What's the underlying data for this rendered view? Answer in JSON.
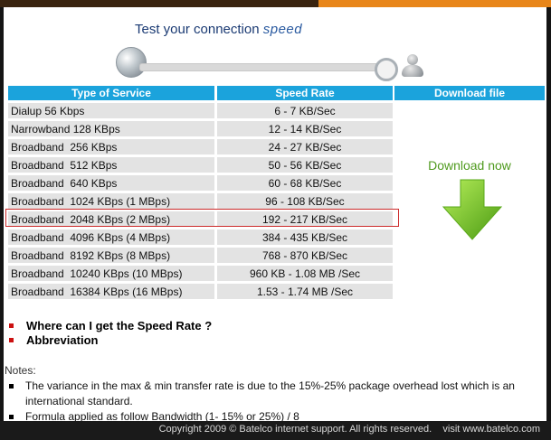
{
  "header": {
    "title_prefix": "Test your connection",
    "title_highlight": "speed"
  },
  "progress": {
    "start_icon": "globe-icon",
    "end_icon": "user-icon"
  },
  "table": {
    "headers": [
      "Type of Service",
      "Speed Rate"
    ],
    "rows": [
      {
        "type": "Dialup 56 Kbps",
        "rate": "6 - 7 KB/Sec"
      },
      {
        "type": "Narrowband 128 KBps",
        "rate": "12 - 14 KB/Sec"
      },
      {
        "type": "Broadband  256 KBps",
        "rate": "24 - 27 KB/Sec"
      },
      {
        "type": "Broadband  512 KBps",
        "rate": "50 - 56 KB/Sec"
      },
      {
        "type": "Broadband  640 KBps",
        "rate": "60 - 68 KB/Sec"
      },
      {
        "type": "Broadband  1024 KBps (1 MBps)",
        "rate": "96 - 108 KB/Sec"
      },
      {
        "type": "Broadband  2048 KBps (2 MBps)",
        "rate": "192 - 217 KB/Sec"
      },
      {
        "type": "Broadband  4096 KBps (4 MBps)",
        "rate": "384 - 435 KB/Sec"
      },
      {
        "type": "Broadband  8192 KBps (8 MBps)",
        "rate": "768 - 870 KB/Sec"
      },
      {
        "type": "Broadband  10240 KBps (10 MBps)",
        "rate": "960 KB - 1.08 MB /Sec"
      },
      {
        "type": "Broadband  16384 KBps (16 MBps)",
        "rate": "1.53 - 1.74 MB /Sec"
      }
    ],
    "highlighted_row": 6
  },
  "download": {
    "header": "Download file",
    "label": "Download now",
    "icon": "download-arrow-icon",
    "color": "#66bb22"
  },
  "links": [
    {
      "label": "Where can I get the Speed Rate ?"
    },
    {
      "label": "Abbreviation"
    }
  ],
  "notes": {
    "label": "Notes:",
    "items": [
      "The variance in the max & min transfer rate is due to the 15%-25% package overhead lost  which is an international standard.",
      "Formula applied as follow  Bandwidth (1- 15% or 25%) / 8"
    ]
  },
  "footer": {
    "copyright": "Copyright 2009 © Batelco internet support. All rights reserved.    visit www.batelco.com"
  },
  "colors": {
    "accent": "#1ba3dc",
    "highlight_border": "#cc2b2b",
    "bullet": "#cc1111"
  }
}
